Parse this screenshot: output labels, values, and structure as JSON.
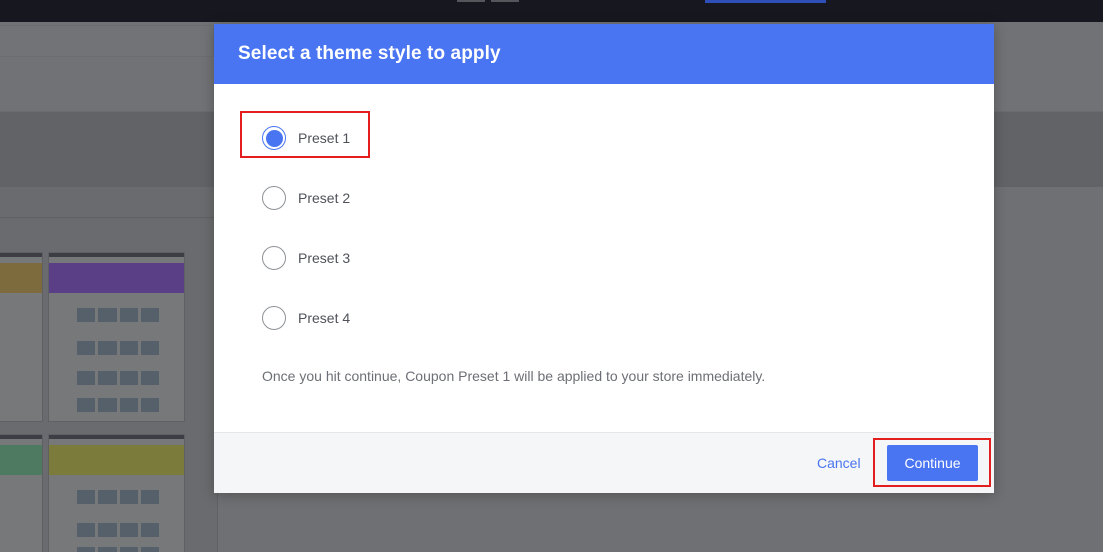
{
  "modal": {
    "title": "Select a theme style to apply",
    "options": [
      {
        "label": "Preset 1",
        "selected": true
      },
      {
        "label": "Preset 2",
        "selected": false
      },
      {
        "label": "Preset 3",
        "selected": false
      },
      {
        "label": "Preset 4",
        "selected": false
      }
    ],
    "note": "Once you hit continue, Coupon Preset 1 will be applied to your store immediately.",
    "cancel_label": "Cancel",
    "continue_label": "Continue"
  },
  "colors": {
    "accent": "#4a75f2",
    "highlight": "#e41e1e",
    "overlay": "#5c5d63"
  },
  "icons": {
    "radio_selected": "radio-checked-icon",
    "radio_unselected": "radio-unchecked-icon"
  }
}
